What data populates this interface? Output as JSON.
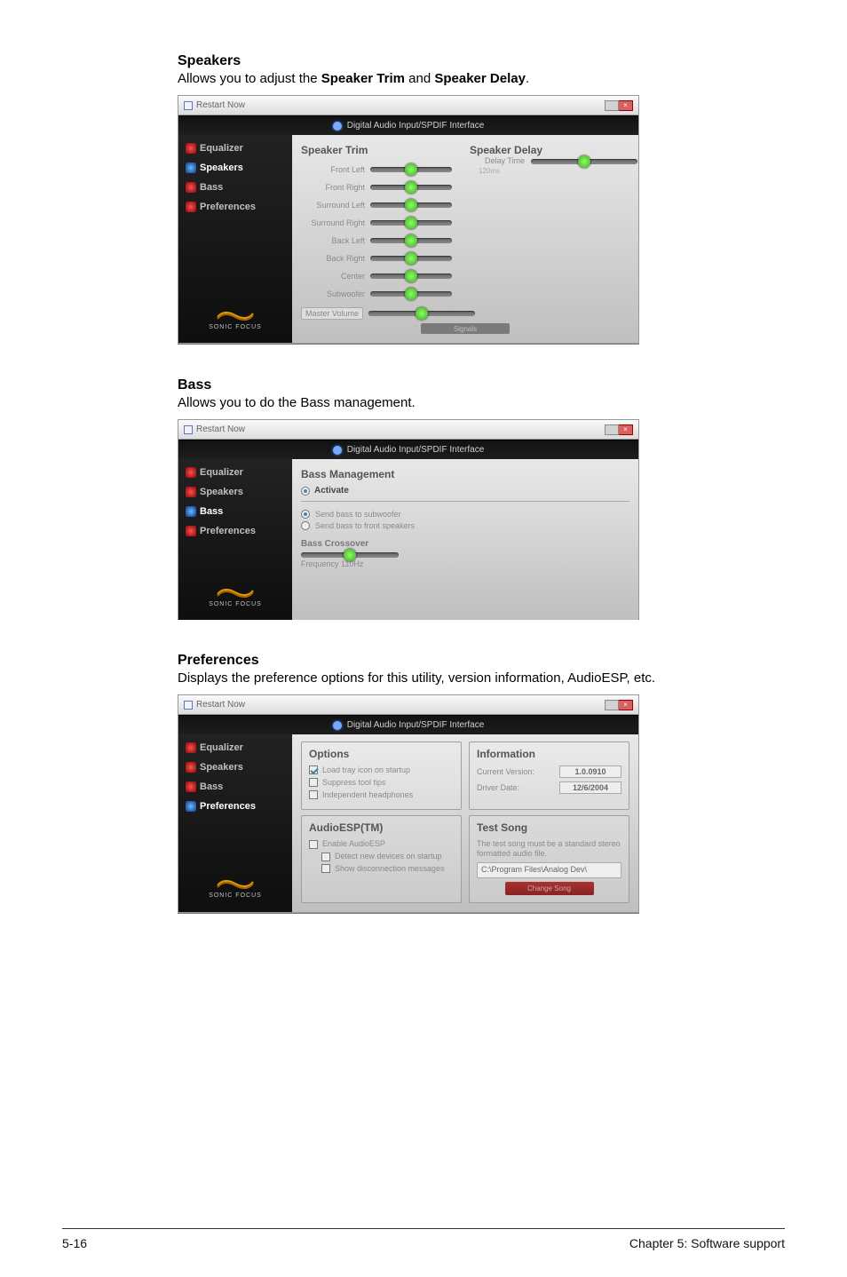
{
  "speakersSection": {
    "title": "Speakers",
    "desc_pre": "Allows you to adjust the ",
    "desc_b1": "Speaker Trim",
    "desc_mid": " and ",
    "desc_b2": "Speaker Delay",
    "desc_post": "."
  },
  "bassSection": {
    "title": "Bass",
    "desc": "Allows you to do the Bass management."
  },
  "prefSection": {
    "title": "Preferences",
    "desc": "Displays the preference options for this utility, version information, AudioESP, etc."
  },
  "win": {
    "title": "Restart Now",
    "darkRow": "Digital Audio Input/SPDIF Interface"
  },
  "nav": {
    "equalizer": "Equalizer",
    "speakers": "Speakers",
    "bass": "Bass",
    "preferences": "Preferences",
    "brand": "SONIC FOCUS"
  },
  "speakers": {
    "h_trim": "Speaker Trim",
    "h_delay": "Speaker Delay",
    "labels": {
      "fl": "Front Left",
      "fr": "Front Right",
      "sl": "Surround Left",
      "sr": "Surround Right",
      "bl": "Back Left",
      "br": "Back Right",
      "c": "Center",
      "sub": "Subwoofer"
    },
    "delay_label": "Delay Time",
    "delay_tail": "120ms",
    "master": "Master Volume",
    "signal": "Signals"
  },
  "bass": {
    "heading": "Bass Management",
    "activate": "Activate",
    "opt1": "Send bass to subwoofer",
    "opt2": "Send bass to front speakers",
    "crossover": "Bass Crossover",
    "freq": "Frequency  110Hz"
  },
  "pref": {
    "options_h": "Options",
    "opt_load": "Load tray icon on startup",
    "opt_supp": "Suppress tool tips",
    "opt_indep": "Independent headphones",
    "esp_h": "AudioESP(TM)",
    "esp_enable": "Enable AudioESP",
    "esp_detect": "Detect new devices on startup",
    "esp_show": "Show disconnection messages",
    "info_h": "Information",
    "cur_ver_l": "Current Version:",
    "cur_ver_v": "1.0.0910",
    "drv_date_l": "Driver Date:",
    "drv_date_v": "12/6/2004",
    "test_h": "Test Song",
    "test_desc": "The test song must be a standard stereo formatted audio file.",
    "test_path": "C:\\Program Files\\Analog Dev\\",
    "change_song": "Change Song"
  },
  "footer": {
    "left": "5-16",
    "right": "Chapter 5: Software support"
  }
}
